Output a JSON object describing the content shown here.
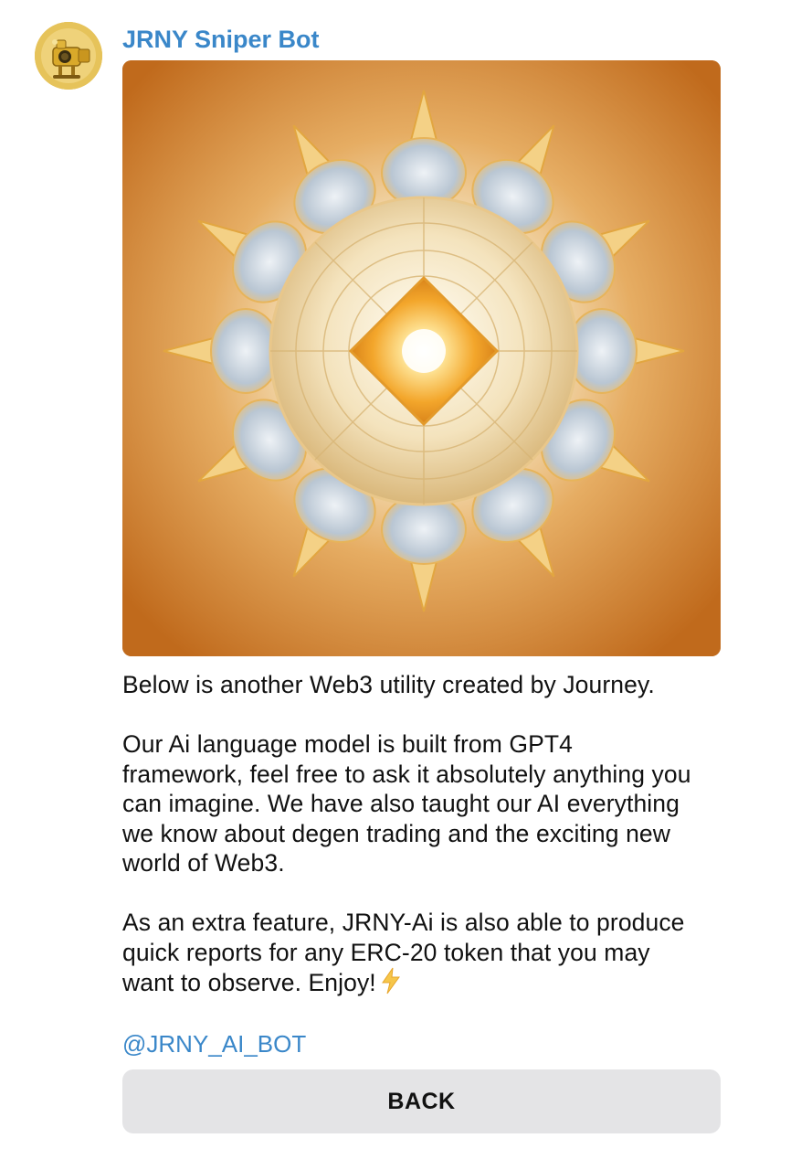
{
  "chat": {
    "sender_name": "JRNY Sniper Bot",
    "message_lines_p1": [
      "Below is another Web3 utility created by Journey."
    ],
    "message_lines_p2": [
      "Our Ai language model is built from GPT4",
      "framework, feel free to ask it absolutely anything you",
      "can imagine. We have also taught our AI everything",
      "we know about degen trading and the exciting new",
      "world of Web3."
    ],
    "message_lines_p3": [
      "As an extra feature, JRNY-Ai is also able to produce",
      "quick reports for any ERC-20 token that you may",
      "want to observe. Enjoy!"
    ],
    "bolt_icon": "lightning-bolt-emoji",
    "mention": "@JRNY_AI_BOT",
    "inline_button_label": "BACK"
  },
  "colors": {
    "link": "#3a87c9",
    "button_bg": "#e4e4e6",
    "text": "#111111"
  }
}
